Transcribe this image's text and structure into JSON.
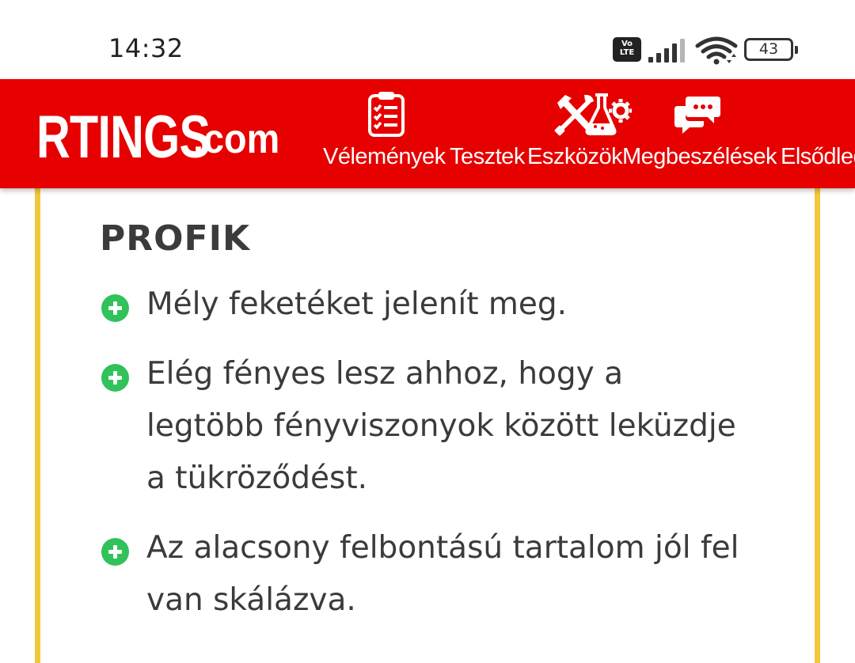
{
  "status_bar": {
    "time": "14:32",
    "volte_label_top": "Vo",
    "volte_label_bottom": "LTE",
    "battery_level": "43"
  },
  "navbar": {
    "logo_main": "RTINGS",
    "logo_tld": ".com",
    "brand_color": "#e60000",
    "items": [
      {
        "label": "Vélemények",
        "icon": "clipboard-checklist-icon"
      },
      {
        "label": "Tesztek",
        "icon": "flask-gear-icon"
      },
      {
        "label": "Eszközök",
        "icon": "tools-icon"
      },
      {
        "label": "Megbeszélések",
        "icon": "chat-bubbles-icon"
      },
      {
        "label": "Elsődleges"
      }
    ]
  },
  "pros": {
    "accent_color": "#f0c83c",
    "icon_color": "#31c25b",
    "title": "PROFIK",
    "items": [
      {
        "text": "Mély feketéket jelenít meg."
      },
      {
        "text": "Elég fényes lesz ahhoz, hogy a legtöbb fényviszonyok között leküzdje a tükröződést."
      },
      {
        "text": "Az alacsony felbontású tartalom jól fel van skálázva."
      }
    ]
  }
}
